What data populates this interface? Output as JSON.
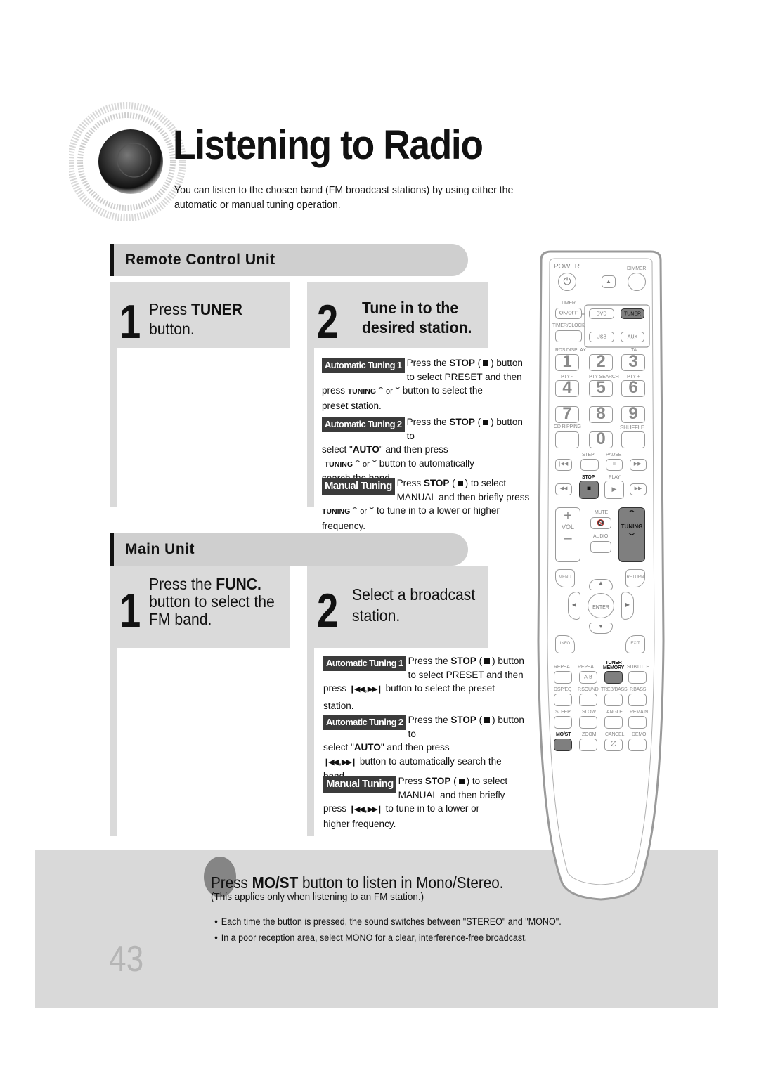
{
  "header": {
    "title": "Listening to Radio",
    "intro": "You can listen to the chosen band (FM broadcast stations) by using either the automatic or manual tuning operation."
  },
  "sections": {
    "remote": {
      "heading": "Remote Control Unit",
      "step1": {
        "number": "1",
        "line1_prefix": "Press ",
        "line1_key": "TUNER",
        "line2": "button."
      },
      "step2": {
        "number": "2",
        "line1": "Tune in to the",
        "line2": "desired station."
      },
      "methods": [
        {
          "tag": "Automatic Tuning 1",
          "lead_a": "Press the ",
          "lead_key": "STOP",
          "lead_b": ") button",
          "line2": "to select PRESET and then",
          "line3_a": "press ",
          "line3_key": "TUNING",
          "or": "or",
          "line3_b": "button to select the",
          "line4": "preset station."
        },
        {
          "tag": "Automatic Tuning 2",
          "lead_a": "Press the ",
          "lead_key": "STOP",
          "lead_b": ") button to",
          "line2_a": "select \"",
          "line2_key": "AUTO",
          "line2_b": "\" and then press",
          "line3_key": "TUNING",
          "or": "or",
          "line3_b": "button to automatically",
          "line4": "search the band."
        },
        {
          "tag": "Manual Tuning",
          "lead_a": "Press ",
          "lead_key": "STOP",
          "lead_b": ") to select",
          "line2": "MANUAL and then briefly press",
          "line3_key": "TUNING",
          "or": "or",
          "line3_b": "to tune in to a lower or higher",
          "line4": "frequency."
        }
      ]
    },
    "main": {
      "heading": "Main Unit",
      "step1": {
        "number": "1",
        "line1_prefix": "Press the ",
        "line1_key": "FUNC.",
        "line2": "button to select the",
        "line3": "FM band."
      },
      "step2": {
        "number": "2",
        "line1": "Select a broadcast",
        "line2": "station."
      },
      "methods": [
        {
          "tag": "Automatic Tuning 1",
          "lead_a": "Press the ",
          "lead_key": "STOP",
          "lead_b": ") button",
          "line2": "to select PRESET and then",
          "line3_a": "press",
          "line3_b": "button to select the preset",
          "line4": "station."
        },
        {
          "tag": "Automatic Tuning 2",
          "lead_a": "Press the ",
          "lead_key": "STOP",
          "lead_b": ") button to",
          "line2_a": "select \"",
          "line2_key": "AUTO",
          "line2_b": "\" and then press",
          "line3_b": "button to automatically search the",
          "line4": "band."
        },
        {
          "tag": "Manual Tuning",
          "lead_a": "Press ",
          "lead_key": "STOP",
          "lead_b": ") to select",
          "line2": "MANUAL and then briefly",
          "line3_a": "press",
          "line3_b": "to tune in to a lower or",
          "line4": "higher frequency."
        }
      ]
    }
  },
  "note": {
    "title_prefix": "Press ",
    "title_key": "MO/ST",
    "title_suffix": " button to listen in Mono/Stereo.",
    "subtitle": "(This applies only when listening to an FM station.)",
    "bullets": [
      "Each time the button is pressed, the sound switches between \"STEREO\" and \"MONO\".",
      "In a poor reception area, select MONO for a clear, interference-free broadcast."
    ]
  },
  "page_number": "43",
  "remote_control": {
    "labels": {
      "power": "POWER",
      "dimmer": "DIMMER",
      "timer": "TIMER",
      "on_off": "ON/OFF",
      "timer_clock": "TIMER/CLOCK",
      "dvd": "DVD",
      "tuner": "TUNER",
      "usb": "USB",
      "aux": "AUX",
      "rds_display": "RDS DISPLAY",
      "ta": "TA",
      "pty_minus": "PTY -",
      "pty_search": "PTY SEARCH",
      "pty_plus": "PTY +",
      "cd_ripping": "CD RIPPING",
      "shuffle": "SHUFFLE",
      "step": "STEP",
      "pause": "PAUSE",
      "stop": "STOP",
      "play": "PLAY",
      "mute": "MUTE",
      "vol": "VOL",
      "audio": "AUDIO",
      "tuning": "TUNING",
      "menu": "MENU",
      "return": "RETURN",
      "enter": "ENTER",
      "info": "INFO",
      "exit": "EXIT",
      "repeat": "REPEAT",
      "repeat_ab": "REPEAT",
      "ab": "A-B",
      "tuner_memory_1": "TUNER",
      "tuner_memory_2": "MEMORY",
      "subtitle": "SUBTITLE",
      "dsp_eq": "DSP/EQ",
      "psound": "P.SOUND",
      "treb_bass": "TREB/BASS",
      "pbass": "P.BASS",
      "sleep": "SLEEP",
      "slow": "SLOW",
      "angle": "ANGLE",
      "remain": "REMAIN",
      "mo_st": "MO/ST",
      "zoom": "ZOOM",
      "cancel": "CANCEL",
      "demo": "DEMO"
    },
    "digits": [
      "1",
      "2",
      "3",
      "4",
      "5",
      "6",
      "7",
      "8",
      "9",
      "0"
    ]
  }
}
